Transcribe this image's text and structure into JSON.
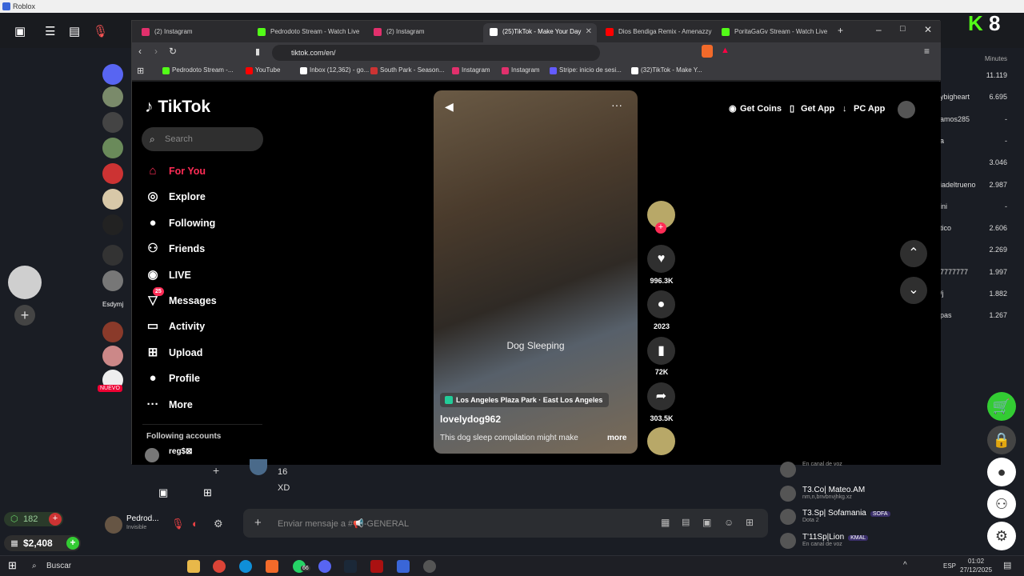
{
  "roblox": {
    "title": "Roblox",
    "money": "$2,408",
    "robux": "182",
    "kick_count": "8",
    "user": "Esdymj",
    "nuevo": "NUEVO"
  },
  "minutes": {
    "header": "Minutes",
    "rows": [
      {
        "name": "",
        "value": "11.119"
      },
      {
        "name": "ybigheart",
        "value": "6.695"
      },
      {
        "name": "amos285",
        "value": "-"
      },
      {
        "name": "a",
        "value": "-"
      },
      {
        "name": "",
        "value": "3.046"
      },
      {
        "name": "iadeltrueno",
        "value": "2.987"
      },
      {
        "name": "ini",
        "value": "-"
      },
      {
        "name": "tico",
        "value": "2.606"
      },
      {
        "name": "",
        "value": "2.269"
      },
      {
        "name": "7777777",
        "value": "1.997"
      },
      {
        "name": "/j",
        "value": "1.882"
      },
      {
        "name": "pas",
        "value": "1.267"
      }
    ]
  },
  "browser": {
    "tabs": [
      {
        "label": "(2) Instagram",
        "color": "#e1306c"
      },
      {
        "label": "Pedrodoto Stream - Watch Live",
        "color": "#53fc18"
      },
      {
        "label": "(2) Instagram",
        "color": "#e1306c"
      },
      {
        "label": "(25)TikTok - Make Your Day",
        "color": "#ffffff",
        "active": true
      },
      {
        "label": "Dios Bendiga Remix - Amenazzy",
        "color": "#ff0000"
      },
      {
        "label": "PoritaGaGv Stream - Watch Live",
        "color": "#53fc18"
      }
    ],
    "url": "tiktok.com/en/",
    "bookmarks": [
      {
        "label": "Pedrodoto Stream -...",
        "color": "#53fc18"
      },
      {
        "label": "YouTube",
        "color": "#ff0000"
      },
      {
        "label": "Inbox (12,362) - go...",
        "color": "#ffffff"
      },
      {
        "label": "South Park - Season...",
        "color": "#c33"
      },
      {
        "label": "Instagram",
        "color": "#e1306c"
      },
      {
        "label": "Instagram",
        "color": "#e1306c"
      },
      {
        "label": "Stripe: inicio de sesi...",
        "color": "#635bff"
      },
      {
        "label": "(32)TikTok - Make Y...",
        "color": "#ffffff"
      }
    ]
  },
  "tiktok": {
    "logo": "TikTok",
    "search_placeholder": "Search",
    "nav": [
      {
        "label": "For You",
        "icon": "home-icon",
        "glyph": "⌂"
      },
      {
        "label": "Explore",
        "icon": "compass-icon",
        "glyph": "◎"
      },
      {
        "label": "Following",
        "icon": "following-icon",
        "glyph": "●"
      },
      {
        "label": "Friends",
        "icon": "friends-icon",
        "glyph": "⚇"
      },
      {
        "label": "LIVE",
        "icon": "live-icon",
        "glyph": "◉"
      },
      {
        "label": "Messages",
        "icon": "messages-icon",
        "glyph": "▽",
        "badge": "25"
      },
      {
        "label": "Activity",
        "icon": "activity-icon",
        "glyph": "▭"
      },
      {
        "label": "Upload",
        "icon": "upload-icon",
        "glyph": "⊞"
      },
      {
        "label": "Profile",
        "icon": "profile-icon",
        "glyph": "●"
      },
      {
        "label": "More",
        "icon": "more-icon",
        "glyph": "···"
      }
    ],
    "following_accounts_label": "Following accounts",
    "following_account": "reg$⊠",
    "top": {
      "coins": "Get Coins",
      "app": "Get App",
      "pc": "PC App"
    },
    "video": {
      "overlay_text": "Dog Sleeping",
      "location": "Los Angeles Plaza Park · East Los Angeles",
      "author": "lovelydog962",
      "caption": "This dog sleep compilation might make",
      "more": "more"
    },
    "actions": {
      "likes": "996.3K",
      "comments": "2023",
      "saves": "72K",
      "shares": "303.5K"
    }
  },
  "discord": {
    "messages": [
      "16",
      "XD"
    ],
    "input_placeholder": "Enviar mensaje a #📢-GENERAL",
    "user": {
      "name": "Pedrod...",
      "status": "Invisible"
    },
    "voice": [
      {
        "name": "",
        "sub": "En canal de voz"
      },
      {
        "name": "T3.Co| Mateo.AM",
        "sub": "nm,n,bnvbnvjhkg.xz"
      },
      {
        "name": "T3.Sp| Sofamania",
        "sub": "Dota 2",
        "tag": "SOFA"
      },
      {
        "name": "T'11Sp|Lion",
        "sub": "En canal de voz",
        "tag": "KMAL"
      }
    ]
  },
  "taskbar": {
    "search": "Buscar",
    "lang": "ESP",
    "time": "01:02",
    "date": "27/12/2025",
    "badge": "66"
  }
}
